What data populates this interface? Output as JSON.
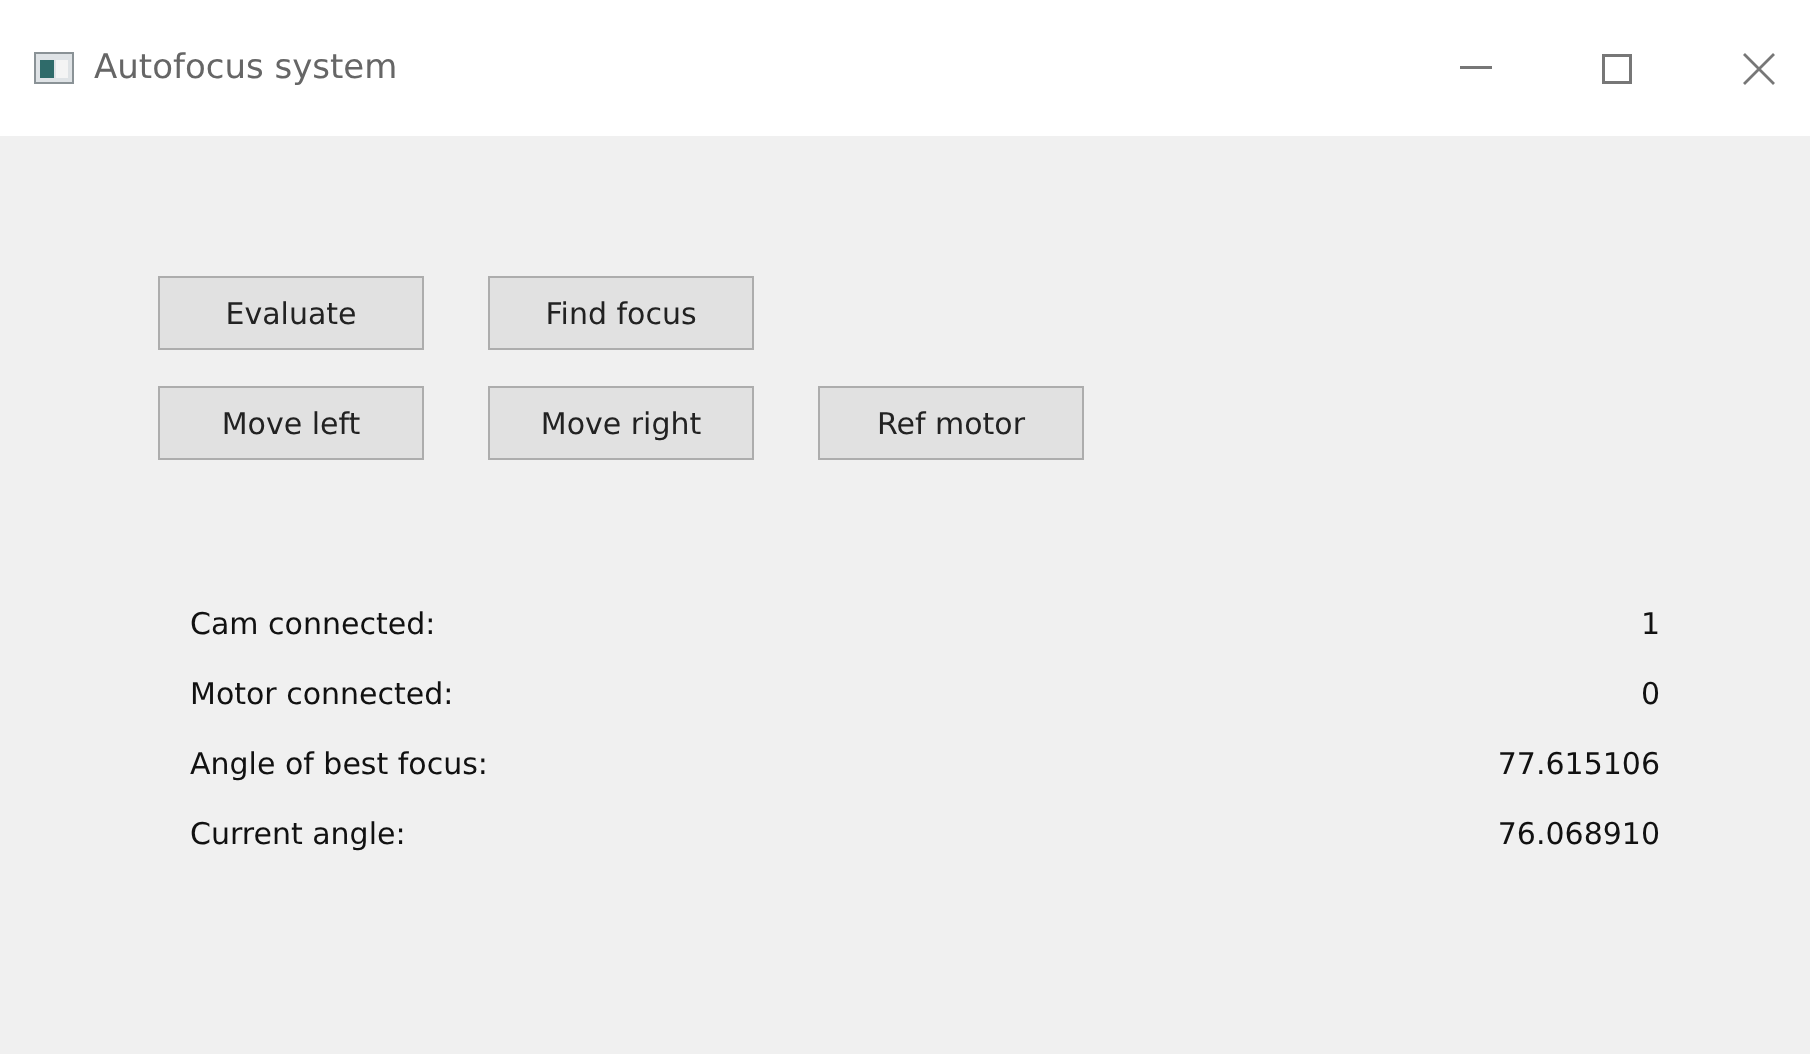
{
  "window": {
    "title": "Autofocus system"
  },
  "button_rows": [
    [
      "Evaluate",
      "Find focus"
    ],
    [
      "Move left",
      "Move right",
      "Ref motor"
    ]
  ],
  "readouts": [
    {
      "label": "Cam connected:",
      "value": "1"
    },
    {
      "label": "Motor connected:",
      "value": "0"
    },
    {
      "label": "Angle of best focus:",
      "value": "77.615106"
    },
    {
      "label": "Current angle:",
      "value": "76.068910"
    }
  ]
}
